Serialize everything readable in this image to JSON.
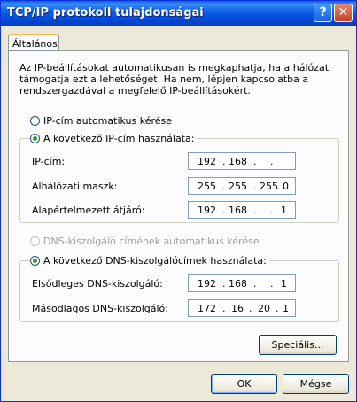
{
  "window": {
    "title": "TCP/IP protokoll tulajdonságai",
    "help_glyph": "?",
    "close_glyph": "✕"
  },
  "tab": {
    "label": "Általános"
  },
  "intro_text": "Az IP-beállításokat automatikusan is megkaphatja, ha a hálózat támogatja ezt a lehetőséget. Ha nem, lépjen kapcsolatba a rendszergazdával a megfelelő IP-beállításokért.",
  "ip_section": {
    "auto_label": "IP-cím automatikus kérése",
    "manual_label": "A következő IP-cím használata:",
    "selected": "manual",
    "fields": [
      {
        "label": "IP-cím:",
        "octets": [
          "192",
          "168",
          "",
          ""
        ]
      },
      {
        "label": "Alhálózati maszk:",
        "octets": [
          "255",
          "255",
          "255",
          "0"
        ]
      },
      {
        "label": "Alapértelmezett átjáró:",
        "octets": [
          "192",
          "168",
          "",
          "1"
        ]
      }
    ]
  },
  "dns_section": {
    "auto_label": "DNS-kiszolgáló címének automatikus kérése",
    "manual_label": "A következő DNS-kiszolgálócímek használata:",
    "selected": "manual",
    "fields": [
      {
        "label": "Elsődleges DNS-kiszolgáló:",
        "octets": [
          "192",
          "168",
          "",
          "1"
        ]
      },
      {
        "label": "Másodlagos DNS-kiszolgáló:",
        "octets": [
          "172",
          "16",
          "20",
          "1"
        ]
      }
    ]
  },
  "buttons": {
    "advanced": "Speciális...",
    "ok": "OK",
    "cancel": "Mégse"
  }
}
